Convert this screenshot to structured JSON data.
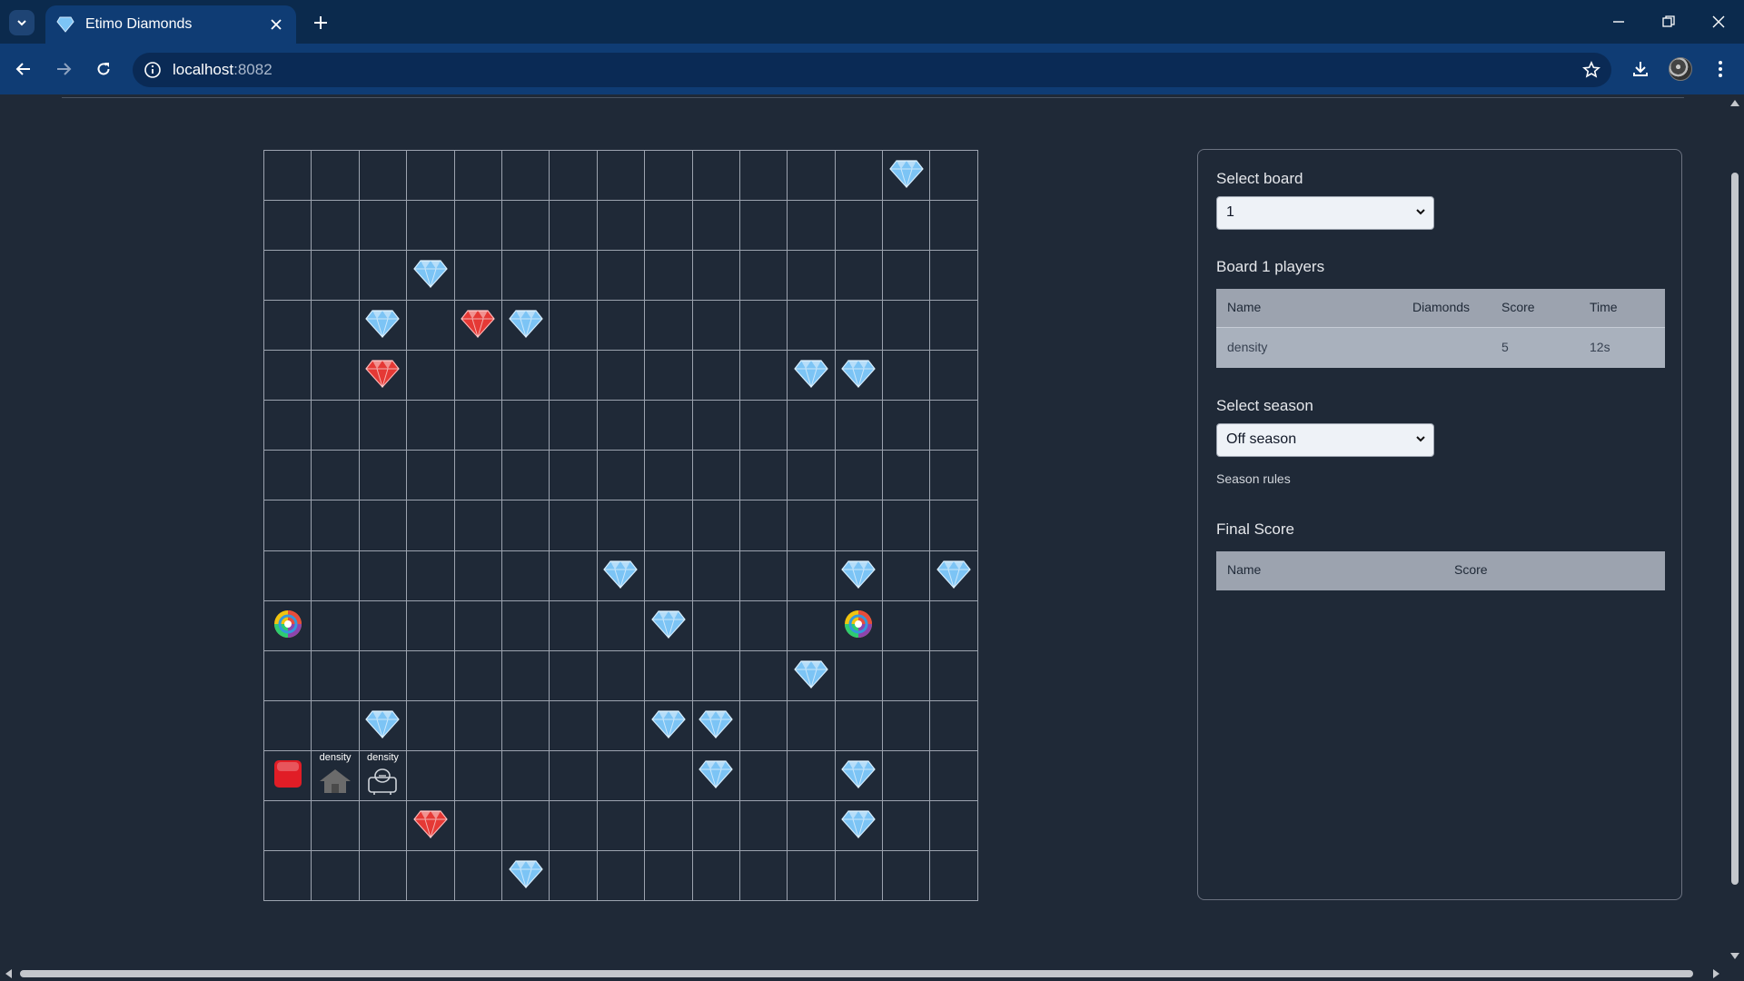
{
  "browser": {
    "tab_title": "Etimo Diamonds",
    "url_host": "localhost",
    "url_port": ":8082"
  },
  "board": {
    "rows": 15,
    "cols": 15,
    "objects": [
      {
        "type": "blue-diamond",
        "row": 0,
        "col": 13
      },
      {
        "type": "blue-diamond",
        "row": 2,
        "col": 3
      },
      {
        "type": "blue-diamond",
        "row": 3,
        "col": 2
      },
      {
        "type": "red-diamond",
        "row": 3,
        "col": 4
      },
      {
        "type": "blue-diamond",
        "row": 3,
        "col": 5
      },
      {
        "type": "red-diamond",
        "row": 4,
        "col": 2
      },
      {
        "type": "blue-diamond",
        "row": 4,
        "col": 11
      },
      {
        "type": "blue-diamond",
        "row": 4,
        "col": 12
      },
      {
        "type": "blue-diamond",
        "row": 8,
        "col": 7
      },
      {
        "type": "blue-diamond",
        "row": 8,
        "col": 12
      },
      {
        "type": "blue-diamond",
        "row": 8,
        "col": 14
      },
      {
        "type": "teleporter",
        "row": 9,
        "col": 0
      },
      {
        "type": "blue-diamond",
        "row": 9,
        "col": 8
      },
      {
        "type": "teleporter",
        "row": 9,
        "col": 12
      },
      {
        "type": "blue-diamond",
        "row": 10,
        "col": 11
      },
      {
        "type": "blue-diamond",
        "row": 11,
        "col": 2
      },
      {
        "type": "blue-diamond",
        "row": 11,
        "col": 8
      },
      {
        "type": "blue-diamond",
        "row": 11,
        "col": 9
      },
      {
        "type": "red-button",
        "row": 12,
        "col": 0
      },
      {
        "type": "base",
        "row": 12,
        "col": 1,
        "label": "density"
      },
      {
        "type": "bot",
        "row": 12,
        "col": 2,
        "label": "density"
      },
      {
        "type": "blue-diamond",
        "row": 12,
        "col": 9
      },
      {
        "type": "blue-diamond",
        "row": 12,
        "col": 12
      },
      {
        "type": "red-diamond",
        "row": 13,
        "col": 3
      },
      {
        "type": "blue-diamond",
        "row": 13,
        "col": 12
      },
      {
        "type": "blue-diamond",
        "row": 14,
        "col": 5
      }
    ]
  },
  "panel": {
    "select_board_label": "Select board",
    "select_board_value": "1",
    "players_heading": "Board 1 players",
    "players_columns": [
      "Name",
      "Diamonds",
      "Score",
      "Time"
    ],
    "players_rows": [
      {
        "name": "density",
        "diamonds": "",
        "score": "5",
        "time": "12s"
      }
    ],
    "select_season_label": "Select season",
    "select_season_value": "Off season",
    "season_rules_link": "Season rules",
    "final_score_heading": "Final Score",
    "final_score_columns": [
      "Name",
      "Score"
    ]
  },
  "colors": {
    "page_bg": "#1f2937",
    "chrome_dark": "#0b2a4d",
    "chrome_toolbar": "#0f3c74",
    "blue_diamond": "#7cc4f5",
    "red_diamond": "#e53935",
    "button_red": "#e11d26"
  }
}
